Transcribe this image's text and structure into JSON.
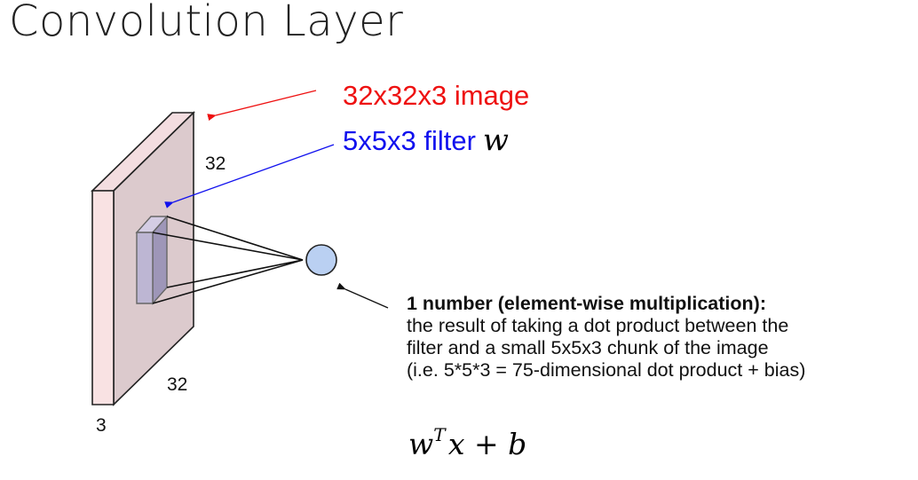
{
  "slide": {
    "title": "Convolution Layer"
  },
  "labels": {
    "image": "32x32x3 image",
    "filter": "5x5x3 filter",
    "filter_symbol": "w",
    "height": "32",
    "width": "32",
    "depth": "3"
  },
  "description": {
    "heading": "1 number (element-wise multiplication):",
    "lines": [
      "the result of taking a dot product between the",
      "filter and a small 5x5x3 chunk of the image",
      "(i.e. 5*5*3 = 75-dimensional dot product + bias)"
    ]
  },
  "formula": {
    "w": "w",
    "superscript": "T",
    "rest": "x + b"
  },
  "colors": {
    "image_label": "#ee1111",
    "filter_label": "#1111ee",
    "volume_front": "#f9e2e3",
    "volume_face": "#dccacd",
    "filter_fill": "#bdb6d3",
    "neuron_fill": "#bad0f2"
  }
}
